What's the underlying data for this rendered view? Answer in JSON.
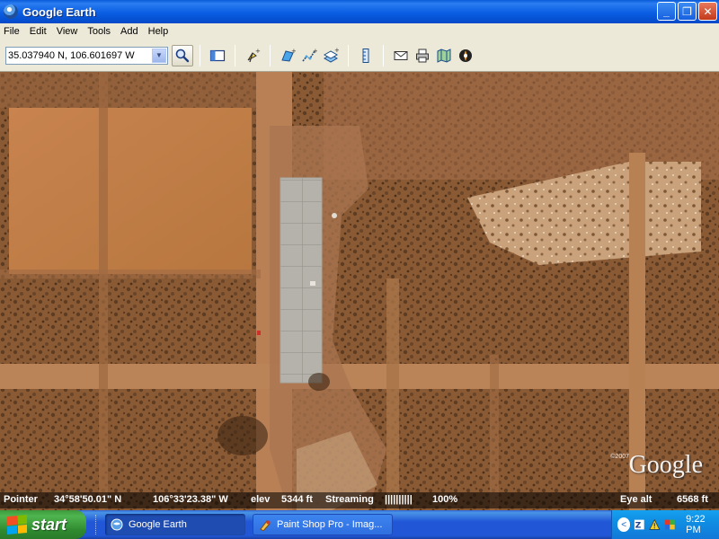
{
  "window": {
    "title": "Google Earth",
    "buttons": {
      "minimize": "_",
      "maximize": "❐",
      "close": "✕"
    }
  },
  "menu": [
    "File",
    "Edit",
    "View",
    "Tools",
    "Add",
    "Help"
  ],
  "toolbar": {
    "search_value": "35.037940 N, 106.601697 W",
    "icons": [
      "sidebar-toggle-icon",
      "placemark-icon",
      "polygon-icon",
      "path-icon",
      "image-overlay-icon",
      "ruler-icon",
      "email-icon",
      "print-icon",
      "maps-icon",
      "sky-icon"
    ]
  },
  "status": {
    "pointer_label": "Pointer",
    "latitude": "34°58'50.01\" N",
    "longitude": "106°33'23.38\" W",
    "elev_label": "elev",
    "elevation": "5344 ft",
    "streaming_label": "Streaming",
    "streaming_bars": "||||||||||",
    "streaming_percent": "100%",
    "eye_alt_label": "Eye alt",
    "eye_alt": "6568 ft"
  },
  "map": {
    "watermark": "Google",
    "copyright": "©2007"
  },
  "taskbar": {
    "start_label": "start",
    "tasks": [
      {
        "label": "Google Earth",
        "active": true
      },
      {
        "label": "Paint Shop Pro - Imag...",
        "active": false
      }
    ],
    "clock": "9:22 PM"
  }
}
